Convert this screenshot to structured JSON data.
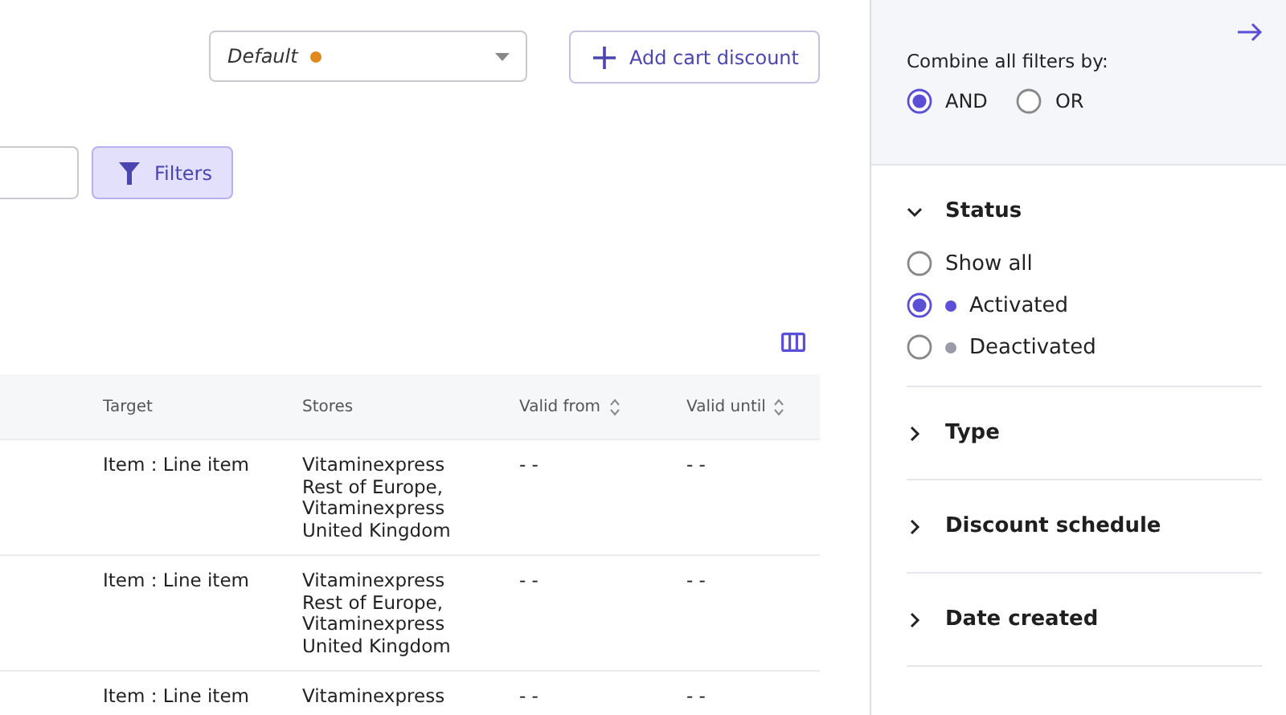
{
  "toolbar": {
    "view_select": {
      "value": "Default",
      "color": "#e08a1e"
    },
    "add_button": "Add cart discount"
  },
  "filters_button": {
    "label": "Filters",
    "selected": true
  },
  "table": {
    "columns": [
      {
        "label": "Target",
        "sortable": false
      },
      {
        "label": "Stores",
        "sortable": false
      },
      {
        "label": "Valid from",
        "sortable": true
      },
      {
        "label": "Valid until",
        "sortable": true
      }
    ],
    "rows": [
      {
        "target": "Item : Line item",
        "stores": [
          "Vitaminexpress",
          "Rest of Europe,",
          "Vitaminexpress",
          "United Kingdom"
        ],
        "valid_from": "- -",
        "valid_until": "- -"
      },
      {
        "target": "Item : Line item",
        "stores": [
          "Vitaminexpress",
          "Rest of Europe,",
          "Vitaminexpress",
          "United Kingdom"
        ],
        "valid_from": "- -",
        "valid_until": "- -"
      },
      {
        "target": "Item : Line item",
        "stores": [
          "Vitaminexpress"
        ],
        "valid_from": "- -",
        "valid_until": "- -"
      }
    ]
  },
  "filter_panel": {
    "combine_label": "Combine all filters by:",
    "combine_options": [
      {
        "label": "AND",
        "selected": true
      },
      {
        "label": "OR",
        "selected": false
      }
    ],
    "sections": [
      {
        "title": "Status",
        "expanded": true,
        "options": [
          {
            "label": "Show all",
            "selected": false
          },
          {
            "label": "Activated",
            "selected": true,
            "color": "#5b4fd6"
          },
          {
            "label": "Deactivated",
            "selected": false,
            "color": "#9a9aa8"
          }
        ]
      },
      {
        "title": "Type",
        "expanded": false
      },
      {
        "title": "Discount schedule",
        "expanded": false
      },
      {
        "title": "Date created",
        "expanded": false
      }
    ]
  }
}
